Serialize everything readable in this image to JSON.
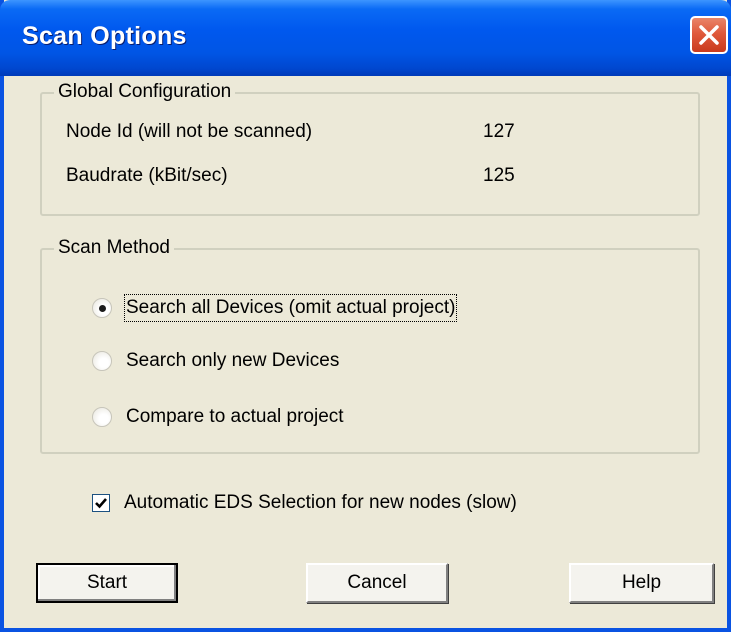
{
  "window": {
    "title": "Scan Options"
  },
  "global_configuration": {
    "legend": "Global Configuration",
    "node_id_label": "Node Id (will not be scanned)",
    "node_id_value": "127",
    "baudrate_label": "Baudrate (kBit/sec)",
    "baudrate_value": "125"
  },
  "scan_method": {
    "legend": "Scan Method",
    "options": [
      {
        "label": "Search all Devices (omit actual project)",
        "selected": true
      },
      {
        "label": "Search only new Devices",
        "selected": false
      },
      {
        "label": "Compare to actual project",
        "selected": false
      }
    ]
  },
  "auto_eds": {
    "label": "Automatic EDS Selection for new nodes (slow)",
    "checked": true
  },
  "buttons": {
    "start": "Start",
    "cancel": "Cancel",
    "help": "Help"
  },
  "colors": {
    "titlebar": "#0058EE",
    "dialog_bg": "#ECE9D8",
    "close_button": "#E0593B"
  },
  "icons": {
    "close": "close-icon",
    "checkmark": "checkmark-icon"
  }
}
